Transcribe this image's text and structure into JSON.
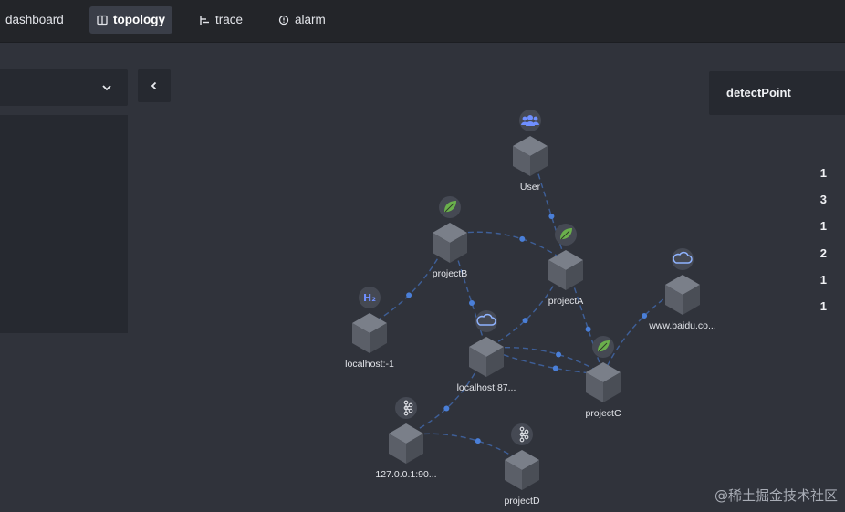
{
  "nav": {
    "items": [
      {
        "label": "dashboard",
        "icon": "dashboard-icon",
        "active": false
      },
      {
        "label": "topology",
        "icon": "topology-icon",
        "active": true
      },
      {
        "label": "trace",
        "icon": "trace-icon",
        "active": false
      },
      {
        "label": "alarm",
        "icon": "alarm-icon",
        "active": false
      }
    ]
  },
  "left_panel": {
    "counts": [
      "1",
      "3",
      "1",
      "2",
      "1",
      "1"
    ]
  },
  "right_panel": {
    "title": "detectPoint"
  },
  "topology": {
    "nodes": [
      {
        "id": "user",
        "label": "User",
        "type": "users-icon"
      },
      {
        "id": "projectB",
        "label": "projectB",
        "type": "spring-leaf-icon"
      },
      {
        "id": "projectA",
        "label": "projectA",
        "type": "spring-leaf-icon"
      },
      {
        "id": "baidu",
        "label": "www.baidu.co...",
        "type": "cloud-icon"
      },
      {
        "id": "h2",
        "label": "localhost:-1",
        "type": "h2-database-icon"
      },
      {
        "id": "local87",
        "label": "localhost:87...",
        "type": "cloud-icon"
      },
      {
        "id": "projectC",
        "label": "projectC",
        "type": "spring-leaf-icon"
      },
      {
        "id": "ip90",
        "label": "127.0.0.1:90...",
        "type": "kafka-icon"
      },
      {
        "id": "projectD",
        "label": "projectD",
        "type": "kafka-icon"
      }
    ],
    "edges": [
      {
        "from": "user",
        "to": "projectA"
      },
      {
        "from": "projectB",
        "to": "projectA"
      },
      {
        "from": "projectB",
        "to": "h2"
      },
      {
        "from": "projectB",
        "to": "local87"
      },
      {
        "from": "projectA",
        "to": "local87"
      },
      {
        "from": "projectA",
        "to": "projectC"
      },
      {
        "from": "local87",
        "to": "projectC"
      },
      {
        "from": "local87",
        "to": "projectC"
      },
      {
        "from": "projectC",
        "to": "baidu"
      },
      {
        "from": "local87",
        "to": "ip90"
      },
      {
        "from": "ip90",
        "to": "projectD"
      }
    ],
    "colors": {
      "edge": "#3e5f98",
      "dot": "#4a7fd8",
      "cube_top": "#7a7f89",
      "cube_left": "#5b5f68",
      "cube_right": "#4a4e56"
    }
  },
  "watermark": "@稀土掘金技术社区"
}
